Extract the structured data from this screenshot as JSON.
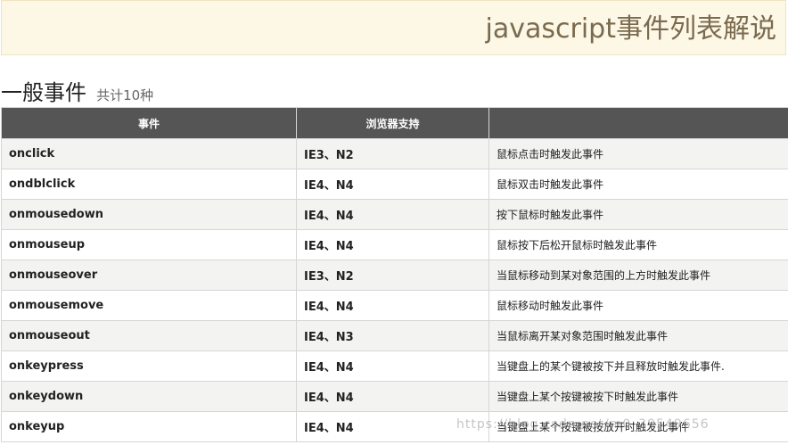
{
  "banner": {
    "title": "javascript事件列表解说"
  },
  "section": {
    "title": "一般事件",
    "subtitle": "共计10种"
  },
  "table": {
    "headers": [
      "事件",
      "浏览器支持",
      ""
    ],
    "rows": [
      [
        "onclick",
        "IE3、N2",
        "鼠标点击时触发此事件"
      ],
      [
        "ondblclick",
        "IE4、N4",
        "鼠标双击时触发此事件"
      ],
      [
        "onmousedown",
        "IE4、N4",
        "按下鼠标时触发此事件"
      ],
      [
        "onmouseup",
        "IE4、N4",
        "鼠标按下后松开鼠标时触发此事件"
      ],
      [
        "onmouseover",
        "IE3、N2",
        "当鼠标移动到某对象范围的上方时触发此事件"
      ],
      [
        "onmousemove",
        "IE4、N4",
        "鼠标移动时触发此事件"
      ],
      [
        "onmouseout",
        "IE4、N3",
        "当鼠标离开某对象范围时触发此事件"
      ],
      [
        "onkeypress",
        "IE4、N4",
        "当键盘上的某个键被按下并且释放时触发此事件."
      ],
      [
        "onkeydown",
        "IE4、N4",
        "当键盘上某个按键被按下时触发此事件"
      ],
      [
        "onkeyup",
        "IE4、N4",
        "当键盘上某个按键被按放开时触发此事件"
      ]
    ]
  },
  "watermark": {
    "text": "https://blog.csdn.net/m0_39549656"
  }
}
